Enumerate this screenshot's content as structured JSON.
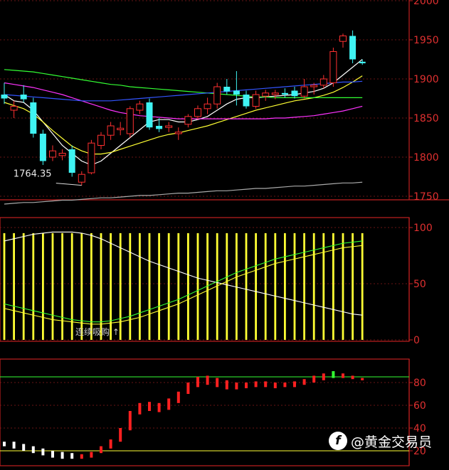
{
  "chart_data": [
    {
      "type": "candlestick",
      "title": "",
      "ylim": [
        1750,
        2000
      ],
      "yticks": [
        1750,
        1800,
        1850,
        1900,
        1950,
        2000
      ],
      "annotation": "1764.35",
      "candles": [
        {
          "o": 1880,
          "h": 1895,
          "l": 1868,
          "c": 1875
        },
        {
          "o": 1860,
          "h": 1872,
          "l": 1850,
          "c": 1865
        },
        {
          "o": 1880,
          "h": 1892,
          "l": 1870,
          "c": 1874
        },
        {
          "o": 1870,
          "h": 1876,
          "l": 1825,
          "c": 1830
        },
        {
          "o": 1830,
          "h": 1835,
          "l": 1790,
          "c": 1795
        },
        {
          "o": 1800,
          "h": 1815,
          "l": 1795,
          "c": 1808
        },
        {
          "o": 1802,
          "h": 1810,
          "l": 1796,
          "c": 1805
        },
        {
          "o": 1810,
          "h": 1815,
          "l": 1775,
          "c": 1780
        },
        {
          "o": 1768,
          "h": 1782,
          "l": 1764,
          "c": 1778
        },
        {
          "o": 1780,
          "h": 1822,
          "l": 1778,
          "c": 1818
        },
        {
          "o": 1815,
          "h": 1832,
          "l": 1810,
          "c": 1828
        },
        {
          "o": 1828,
          "h": 1845,
          "l": 1822,
          "c": 1840
        },
        {
          "o": 1835,
          "h": 1845,
          "l": 1828,
          "c": 1837
        },
        {
          "o": 1830,
          "h": 1865,
          "l": 1825,
          "c": 1862
        },
        {
          "o": 1860,
          "h": 1872,
          "l": 1855,
          "c": 1868
        },
        {
          "o": 1870,
          "h": 1875,
          "l": 1835,
          "c": 1838
        },
        {
          "o": 1840,
          "h": 1850,
          "l": 1832,
          "c": 1836
        },
        {
          "o": 1838,
          "h": 1845,
          "l": 1832,
          "c": 1840
        },
        {
          "o": 1830,
          "h": 1838,
          "l": 1822,
          "c": 1832
        },
        {
          "o": 1842,
          "h": 1855,
          "l": 1838,
          "c": 1852
        },
        {
          "o": 1852,
          "h": 1866,
          "l": 1848,
          "c": 1862
        },
        {
          "o": 1862,
          "h": 1876,
          "l": 1855,
          "c": 1868
        },
        {
          "o": 1868,
          "h": 1895,
          "l": 1862,
          "c": 1890
        },
        {
          "o": 1890,
          "h": 1900,
          "l": 1880,
          "c": 1884
        },
        {
          "o": 1885,
          "h": 1910,
          "l": 1866,
          "c": 1880
        },
        {
          "o": 1880,
          "h": 1885,
          "l": 1862,
          "c": 1865
        },
        {
          "o": 1865,
          "h": 1885,
          "l": 1862,
          "c": 1880
        },
        {
          "o": 1878,
          "h": 1886,
          "l": 1872,
          "c": 1882
        },
        {
          "o": 1880,
          "h": 1886,
          "l": 1874,
          "c": 1882
        },
        {
          "o": 1882,
          "h": 1888,
          "l": 1876,
          "c": 1880
        },
        {
          "o": 1885,
          "h": 1890,
          "l": 1875,
          "c": 1878
        },
        {
          "o": 1878,
          "h": 1900,
          "l": 1875,
          "c": 1890
        },
        {
          "o": 1890,
          "h": 1895,
          "l": 1880,
          "c": 1892
        },
        {
          "o": 1892,
          "h": 1905,
          "l": 1888,
          "c": 1900
        },
        {
          "o": 1895,
          "h": 1940,
          "l": 1890,
          "c": 1935
        },
        {
          "o": 1948,
          "h": 1958,
          "l": 1940,
          "c": 1955
        },
        {
          "o": 1955,
          "h": 1962,
          "l": 1920,
          "c": 1925
        },
        {
          "o": 1922,
          "h": 1925,
          "l": 1918,
          "c": 1920
        }
      ],
      "ma": [
        {
          "color": "#ffffff",
          "values": [
            1880,
            1872,
            1870,
            1860,
            1845,
            1830,
            1815,
            1805,
            1795,
            1790,
            1795,
            1805,
            1815,
            1825,
            1835,
            1845,
            1848,
            1848,
            1845,
            1845,
            1848,
            1852,
            1860,
            1868,
            1874,
            1876,
            1876,
            1877,
            1878,
            1879,
            1880,
            1882,
            1884,
            1888,
            1895,
            1905,
            1915,
            1925
          ]
        },
        {
          "color": "#ffff33",
          "values": [
            1870,
            1866,
            1862,
            1855,
            1845,
            1834,
            1824,
            1814,
            1808,
            1804,
            1804,
            1806,
            1810,
            1814,
            1818,
            1822,
            1826,
            1829,
            1831,
            1834,
            1837,
            1840,
            1844,
            1848,
            1852,
            1856,
            1860,
            1863,
            1866,
            1869,
            1872,
            1874,
            1876,
            1879,
            1883,
            1889,
            1896,
            1904
          ]
        },
        {
          "color": "#ff33ff",
          "values": [
            1895,
            1893,
            1891,
            1889,
            1886,
            1883,
            1880,
            1876,
            1872,
            1868,
            1864,
            1860,
            1857,
            1855,
            1853,
            1852,
            1851,
            1850,
            1849,
            1849,
            1849,
            1849,
            1849,
            1849,
            1849,
            1849,
            1849,
            1849,
            1850,
            1850,
            1851,
            1852,
            1853,
            1855,
            1857,
            1859,
            1862,
            1865
          ]
        },
        {
          "color": "#33ff33",
          "values": [
            1912,
            1911,
            1910,
            1909,
            1907,
            1905,
            1903,
            1901,
            1899,
            1897,
            1895,
            1893,
            1892,
            1890,
            1889,
            1888,
            1887,
            1886,
            1885,
            1884,
            1883,
            1882,
            1881,
            1880,
            1879,
            1878,
            1877,
            1877,
            1876,
            1876,
            1876,
            1876,
            1876,
            1876,
            1876,
            1876,
            1876,
            1876
          ]
        },
        {
          "color": "#3355ff",
          "values": [
            1880,
            1879,
            1878,
            1877,
            1876,
            1875,
            1874,
            1873,
            1872,
            1872,
            1872,
            1872,
            1873,
            1874,
            1875,
            1876,
            1877,
            1878,
            1879,
            1880,
            1881,
            1882,
            1883,
            1884,
            1885,
            1886,
            1887,
            1888,
            1889,
            1890,
            1891,
            1892,
            1893,
            1894,
            1895,
            1896,
            1896,
            1897
          ]
        },
        {
          "color": "#aaaaaa",
          "values": [
            1740,
            1741,
            1742,
            1742,
            1743,
            1744,
            1745,
            1745,
            1746,
            1747,
            1748,
            1748,
            1749,
            1750,
            1751,
            1751,
            1752,
            1753,
            1754,
            1754,
            1755,
            1756,
            1757,
            1757,
            1758,
            1759,
            1760,
            1760,
            1761,
            1762,
            1763,
            1763,
            1764,
            1765,
            1766,
            1767,
            1767,
            1768
          ]
        }
      ]
    },
    {
      "type": "bar",
      "title": "",
      "ylim": [
        0,
        100
      ],
      "yticks": [
        0,
        50,
        100
      ],
      "overlay_text": "连续吸购 ↑",
      "bar_value": 95,
      "bar_color": "#ffff33",
      "lines": [
        {
          "color": "#ffffff",
          "values": [
            88,
            90,
            92,
            94,
            95,
            96,
            96,
            96,
            95,
            93,
            90,
            86,
            82,
            78,
            74,
            70,
            67,
            64,
            61,
            58,
            55,
            53,
            51,
            49,
            47,
            45,
            43,
            41,
            39,
            37,
            35,
            33,
            31,
            29,
            27,
            25,
            23,
            22
          ]
        },
        {
          "color": "#33ff33",
          "values": [
            32,
            30,
            28,
            26,
            24,
            22,
            20,
            18,
            17,
            16,
            16,
            17,
            19,
            21,
            24,
            27,
            30,
            33,
            36,
            40,
            44,
            48,
            52,
            56,
            60,
            63,
            66,
            69,
            72,
            74,
            76,
            78,
            80,
            82,
            84,
            86,
            87,
            88
          ]
        },
        {
          "color": "#ffff33",
          "values": [
            28,
            26,
            24,
            22,
            20,
            18,
            17,
            16,
            15,
            14,
            14,
            15,
            16,
            18,
            20,
            23,
            26,
            29,
            32,
            36,
            40,
            44,
            48,
            52,
            56,
            59,
            62,
            65,
            68,
            70,
            72,
            74,
            76,
            78,
            80,
            82,
            83,
            84
          ]
        }
      ]
    },
    {
      "type": "bar",
      "title": "",
      "ylim": [
        10,
        100
      ],
      "yticks": [
        20,
        40,
        60,
        80
      ],
      "hlines": [
        85,
        20
      ],
      "bar_colors": {
        "up": "#ff2020",
        "down": "#ffffff",
        "peak": "#33ff33"
      },
      "bars": [
        {
          "base": 24,
          "top": 28,
          "dir": "down"
        },
        {
          "base": 22,
          "top": 28,
          "dir": "down"
        },
        {
          "base": 20,
          "top": 26,
          "dir": "down"
        },
        {
          "base": 18,
          "top": 24,
          "dir": "down"
        },
        {
          "base": 16,
          "top": 22,
          "dir": "down"
        },
        {
          "base": 14,
          "top": 20,
          "dir": "down"
        },
        {
          "base": 13,
          "top": 19,
          "dir": "down"
        },
        {
          "base": 13,
          "top": 18,
          "dir": "down"
        },
        {
          "base": 13,
          "top": 17,
          "dir": "up"
        },
        {
          "base": 14,
          "top": 19,
          "dir": "up"
        },
        {
          "base": 18,
          "top": 24,
          "dir": "up"
        },
        {
          "base": 22,
          "top": 30,
          "dir": "up"
        },
        {
          "base": 28,
          "top": 40,
          "dir": "up"
        },
        {
          "base": 38,
          "top": 55,
          "dir": "up"
        },
        {
          "base": 52,
          "top": 62,
          "dir": "up"
        },
        {
          "base": 55,
          "top": 63,
          "dir": "up"
        },
        {
          "base": 54,
          "top": 62,
          "dir": "up"
        },
        {
          "base": 56,
          "top": 66,
          "dir": "up"
        },
        {
          "base": 62,
          "top": 72,
          "dir": "up"
        },
        {
          "base": 70,
          "top": 80,
          "dir": "up"
        },
        {
          "base": 76,
          "top": 85,
          "dir": "up"
        },
        {
          "base": 78,
          "top": 86,
          "dir": "up"
        },
        {
          "base": 76,
          "top": 84,
          "dir": "up"
        },
        {
          "base": 74,
          "top": 82,
          "dir": "up"
        },
        {
          "base": 74,
          "top": 80,
          "dir": "up"
        },
        {
          "base": 75,
          "top": 80,
          "dir": "up"
        },
        {
          "base": 76,
          "top": 81,
          "dir": "up"
        },
        {
          "base": 76,
          "top": 81,
          "dir": "up"
        },
        {
          "base": 75,
          "top": 80,
          "dir": "up"
        },
        {
          "base": 76,
          "top": 80,
          "dir": "up"
        },
        {
          "base": 76,
          "top": 81,
          "dir": "up"
        },
        {
          "base": 78,
          "top": 83,
          "dir": "up"
        },
        {
          "base": 80,
          "top": 86,
          "dir": "up"
        },
        {
          "base": 82,
          "top": 88,
          "dir": "up"
        },
        {
          "base": 84,
          "top": 90,
          "dir": "peak"
        },
        {
          "base": 84,
          "top": 88,
          "dir": "up"
        },
        {
          "base": 83,
          "top": 86,
          "dir": "up"
        },
        {
          "base": 82,
          "top": 84,
          "dir": "up"
        }
      ]
    }
  ],
  "watermark": {
    "text": "@黄金交易员",
    "logo": "f",
    "icon": "toutiao-logo-icon"
  }
}
